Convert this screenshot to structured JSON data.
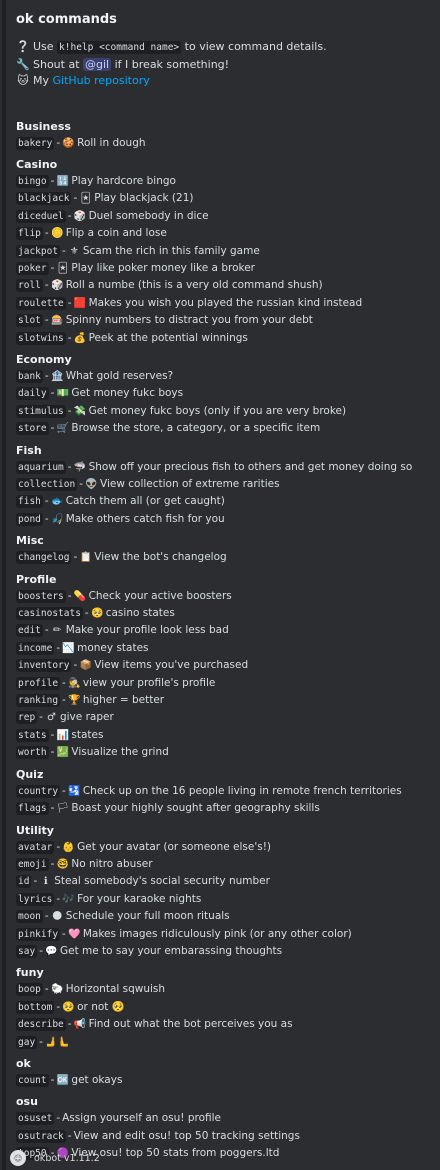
{
  "title": "ok commands",
  "intro": {
    "line1": {
      "icon": "❔",
      "pre": "Use ",
      "code": "k!help <command name>",
      "post": " to view command details."
    },
    "line2": {
      "icon": "🔧",
      "pre": "Shout at ",
      "mention": "@gil",
      "post": " if I break something!"
    },
    "line3": {
      "icon": "🐱",
      "pre": "My ",
      "link": "GitHub repository"
    }
  },
  "sections": [
    {
      "title": "Business",
      "commands": [
        {
          "name": "bakery",
          "icon": "🍪",
          "desc": "Roll in dough"
        }
      ]
    },
    {
      "title": "Casino",
      "commands": [
        {
          "name": "bingo",
          "icon": "🔢",
          "desc": "Play hardcore bingo"
        },
        {
          "name": "blackjack",
          "icon": "🃏",
          "desc": "Play blackjack (21)"
        },
        {
          "name": "diceduel",
          "icon": "🎲",
          "desc": "Duel somebody in dice"
        },
        {
          "name": "flip",
          "icon": "🪙",
          "desc": "Flip a coin and lose"
        },
        {
          "name": "jackpot",
          "icon": "⚜",
          "desc": "Scam the rich in this family game"
        },
        {
          "name": "poker",
          "icon": "🃏",
          "desc": "Play like poker money like a broker"
        },
        {
          "name": "roll",
          "icon": "🎲",
          "desc": "Roll a numbe (this is a very old command shush)"
        },
        {
          "name": "roulette",
          "icon": "🟥",
          "desc": "Makes you wish you played the russian kind instead"
        },
        {
          "name": "slot",
          "icon": "🎰",
          "desc": "Spinny numbers to distract you from your debt"
        },
        {
          "name": "slotwins",
          "icon": "💰",
          "desc": "Peek at the potential winnings"
        }
      ]
    },
    {
      "title": "Economy",
      "commands": [
        {
          "name": "bank",
          "icon": "🏦",
          "desc": "What gold reserves?"
        },
        {
          "name": "daily",
          "icon": "💵",
          "desc": "Get money fukc boys"
        },
        {
          "name": "stimulus",
          "icon": "💸",
          "desc": "Get money fukc boys (only if you are very broke)"
        },
        {
          "name": "store",
          "icon": "🛒",
          "desc": "Browse the store, a category, or a specific item"
        }
      ]
    },
    {
      "title": "Fish",
      "commands": [
        {
          "name": "aquarium",
          "icon": "🦈",
          "desc": "Show off your precious fish to others and get money doing so"
        },
        {
          "name": "collection",
          "icon": "👽",
          "desc": "View collection of extreme rarities"
        },
        {
          "name": "fish",
          "icon": "🐟",
          "desc": "Catch them all (or get caught)"
        },
        {
          "name": "pond",
          "icon": "🎣",
          "desc": "Make others catch fish for you"
        }
      ]
    },
    {
      "title": "Misc",
      "commands": [
        {
          "name": "changelog",
          "icon": "📋",
          "desc": "View the bot's changelog"
        }
      ]
    },
    {
      "title": "Profile",
      "commands": [
        {
          "name": "boosters",
          "icon": "💊",
          "desc": "Check your active boosters"
        },
        {
          "name": "casinostats",
          "icon": "🥺",
          "desc": "casino states"
        },
        {
          "name": "edit",
          "icon": "✏",
          "desc": "Make your profile look less bad"
        },
        {
          "name": "income",
          "icon": "📉",
          "desc": "money states"
        },
        {
          "name": "inventory",
          "icon": "📦",
          "desc": "View items you've purchased"
        },
        {
          "name": "profile",
          "icon": "🕵",
          "desc": "view your profile's profile"
        },
        {
          "name": "ranking",
          "icon": "🏆",
          "desc": "higher = better"
        },
        {
          "name": "rep",
          "icon": "♂",
          "desc": "give raper"
        },
        {
          "name": "stats",
          "icon": "📊",
          "desc": "states"
        },
        {
          "name": "worth",
          "icon": "💹",
          "desc": "Visualize the grind"
        }
      ]
    },
    {
      "title": "Quiz",
      "commands": [
        {
          "name": "country",
          "icon": "🛂",
          "desc": "Check up on the 16 people living in remote french territories"
        },
        {
          "name": "flags",
          "icon": "🏳",
          "desc": "Boast your highly sought after geography skills"
        }
      ]
    },
    {
      "title": "Utility",
      "commands": [
        {
          "name": "avatar",
          "icon": "👶",
          "desc": "Get your avatar (or someone else's!)"
        },
        {
          "name": "emoji",
          "icon": "🤓",
          "desc": "No nitro abuser"
        },
        {
          "name": "id",
          "icon": "ℹ",
          "desc": "Steal somebody's social security number"
        },
        {
          "name": "lyrics",
          "icon": "🎶",
          "desc": "For your karaoke nights"
        },
        {
          "name": "moon",
          "icon": "🌑",
          "desc": "Schedule your full moon rituals"
        },
        {
          "name": "pinkify",
          "icon": "🩷",
          "desc": "Makes images ridiculously pink (or any other color)"
        },
        {
          "name": "say",
          "icon": "💬",
          "desc": "Get me to say your embarassing thoughts"
        }
      ]
    },
    {
      "title": "funy",
      "commands": [
        {
          "name": "boop",
          "icon": "🐑",
          "desc": "Horizontal sqwuish"
        },
        {
          "name": "bottom",
          "icon": "🥺",
          "desc": "or not 🥺"
        },
        {
          "name": "describe",
          "icon": "📢",
          "desc": "Find out what the bot perceives you as"
        },
        {
          "name": "gay",
          "icon": "🫸🫷",
          "desc": ""
        }
      ]
    },
    {
      "title": "ok",
      "commands": [
        {
          "name": "count",
          "icon": "🆗",
          "desc": "get okays"
        }
      ]
    },
    {
      "title": "osu",
      "commands": [
        {
          "name": "osuset",
          "icon": "",
          "desc": "Assign yourself an osu! profile"
        },
        {
          "name": "osutrack",
          "icon": "",
          "desc": "View and edit osu! top 50 tracking settings"
        },
        {
          "name": "top50",
          "icon": "🟣",
          "desc": "View osu! top 50 stats from poggers.ltd"
        }
      ]
    }
  ],
  "footer": {
    "text": "okbot v1.11.2",
    "avatar_icon": "☺"
  },
  "colors": {
    "background": "#2b2d31",
    "code_bg": "#1e1f22",
    "link": "#00a8fc",
    "mention_bg": "#3c4270"
  }
}
